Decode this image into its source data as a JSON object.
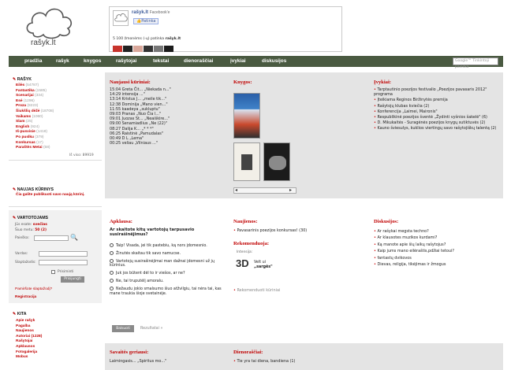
{
  "site": {
    "logo_text": "rašyk.lt"
  },
  "facebook": {
    "page_name": "rašyk.lt",
    "page_sub": "Facebook'e",
    "like_label": "Patinka",
    "count_text": "5 100 žmonėms (-ų) patinka",
    "count_name": "rašyk.lt"
  },
  "nav": {
    "items": [
      "pradžia",
      "rašyk",
      "knygos",
      "rašytojai",
      "tekstai",
      "dienoraščiai",
      "įvykiai",
      "diskusijos"
    ],
    "search_placeholder": "Google™ Tinkintoji paieška"
  },
  "sidebar": {
    "rasyk_title": "RAŠYK",
    "genres": [
      {
        "name": "Eilės",
        "count": "(54787)"
      },
      {
        "name": "Fantastika",
        "count": "(1585)"
      },
      {
        "name": "Scenarijai",
        "count": "(334)"
      },
      {
        "name": "Esė",
        "count": "(1296)"
      },
      {
        "name": "Proza",
        "count": "(8223)"
      },
      {
        "name": "Šiukšlių dėžė",
        "count": "(18708)"
      },
      {
        "name": "Vaikams",
        "count": "(1060)"
      },
      {
        "name": "Slam",
        "count": "(25)"
      },
      {
        "name": "English",
        "count": "(924)"
      },
      {
        "name": "Iš-pusvisie",
        "count": "(1418)"
      },
      {
        "name": "Po puslku",
        "count": "(379)"
      },
      {
        "name": "Konkursas",
        "count": "(17)"
      },
      {
        "name": "Paraštės Metai",
        "count": "(58)"
      }
    ],
    "total_text": "Iš viso: 89919",
    "new_member_title": "NAUJAS KŪRINYS",
    "new_member_text": "Čia galite publikuoti savo naują kūrinį.",
    "users_title": "VARTOTOJAMS",
    "online_label": "Jūs esate:",
    "online_value": "svečias",
    "wait_label": "Šiuo metu:",
    "wait_value": "50 (2)",
    "pass_label": "Paieška:",
    "user_label": "Vardas:",
    "password_label": "Slaptažodis:",
    "remember_label": "Prisiminti",
    "login_button": "Prisijungti",
    "forgot_link": "Pamiršote slaptažodį?",
    "register_link": "Registracija",
    "other_title": "KITA",
    "other_links": [
      "Apie rašyk",
      "Pagalba",
      "Naujienos",
      "Autoriai (1228)",
      "Rašytojai",
      "Apklausos",
      "Fotogalerija",
      "Mobus"
    ]
  },
  "latest": {
    "title": "Naujausi kūriniai:",
    "items": [
      "15:04 Greta Čit... „Niekada n...\"",
      "14:29 intensija ...\"",
      "13:14 Kristus J... „meile tik...\"",
      "12:38 Dominija „Mano vien...\"",
      "11:55 kaadeya „sukluptu\"",
      "09:03 Pranas „Nuo Čia l...\"",
      "09:01 Juozas St... „Neaiškire...\"",
      "09:00 Senamiadlius „Ne (22)\"",
      "08:27 Dalija K... „* * *\"",
      "06:25 Raistinė „Pamudalas\"",
      "00:49 D L „Lema\"",
      "00:25 veliau „Vilniaus ...\""
    ]
  },
  "books": {
    "title": "Knygos:"
  },
  "events": {
    "title": "Įvykiai:",
    "items": [
      "Tarptautinio poezijos festivalio „Poezijos pavasaris 2012\" programa",
      "Įteikiama Reginos Biržinytės premija",
      "Rašytojų klubas kviečia (2)",
      "Konferencija „Laimei, Maironis\"",
      "Respublikinė poezijos šventė „Žydinti vyšnios šakelė\" (6)",
      "D. Mikukaitės - Suragėnės poezijos knygų sutiktuvės (2)",
      "Kauno šviesulys, kuklios viertingų savo rašytojiškų talentą (2)"
    ]
  },
  "poll": {
    "title": "Apklausa:",
    "question": "Ar skaitote kitų vartotojų tarpusavio susirašinėjimus?",
    "options": [
      "Taip! Visada, jei tik pastebiu, ką nors įdomesnio.",
      "Žinutės skaitau tik savo namucse.",
      "Vartotojų susirašinėjimai man dažnai įdomesni už jų kūrinius.",
      "Juk jos būtent dėl to ir viešos, ar ne?",
      "Ne, tai truputėlį amoralu.",
      "Nežaudu jokio smalsumo šiuo atžvilgiu, tai nėra tai, kas mane traukia šioje svetainėje."
    ],
    "vote_button": "Balsuoti",
    "results_link": "Rezultatai »"
  },
  "news": {
    "title": "Naujienos:",
    "items": [
      "Pavasarinis poezijos konkursas! (30)"
    ]
  },
  "recommend": {
    "title": "Rekomenduoja:",
    "who": "Intensija:",
    "text_line1": "Velt ui",
    "text_line2": "„sargės\"",
    "more": "Rekomenduoti kūriniai"
  },
  "discussions": {
    "title": "Diskusijos:",
    "items": [
      "Ar rašykai megsta techno?",
      "Ar klausotes muzikos kurdami?",
      "Ką manote apie šių laikų rašytojus?",
      "Kaip jums mano eilėraštis,pdžiai tetoui?",
      "fantastų dvikovos",
      "Dievas, religija, tikėjimas ir žmogus"
    ]
  },
  "week_best": {
    "title": "Savaitės geriausi:",
    "items": [
      "Laimingasis... „Spiritus mo...\""
    ]
  },
  "diary": {
    "title": "Dienoraščiai:",
    "items": [
      "Tie yra tai diena, bandiena (1)"
    ]
  },
  "colors": {
    "nav_bg": "#4a5a41",
    "accent_red": "#c00000",
    "panel_bg": "#e4e4e4"
  }
}
